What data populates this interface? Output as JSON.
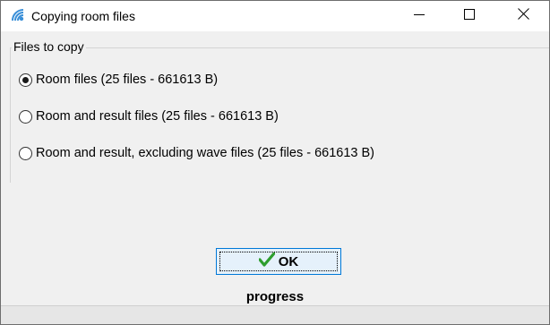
{
  "window": {
    "title": "Copying room files",
    "app_icon": "wave-logo-icon",
    "controls": [
      "minimize-icon",
      "maximize-icon",
      "close-icon"
    ]
  },
  "files_group": {
    "label": "Files to copy",
    "options": [
      {
        "label": "Room files  (25 files - 661613  B)",
        "checked": true
      },
      {
        "label": "Room and result files  (25 files - 661613  B)",
        "checked": false
      },
      {
        "label": "Room and result, excluding wave files  (25 files - 661613  B)",
        "checked": false
      }
    ]
  },
  "ok_button": {
    "label": "OK",
    "icon": "checkmark-icon",
    "accent_color": "#2e9e2e"
  },
  "status": {
    "progress_label": "progress"
  }
}
